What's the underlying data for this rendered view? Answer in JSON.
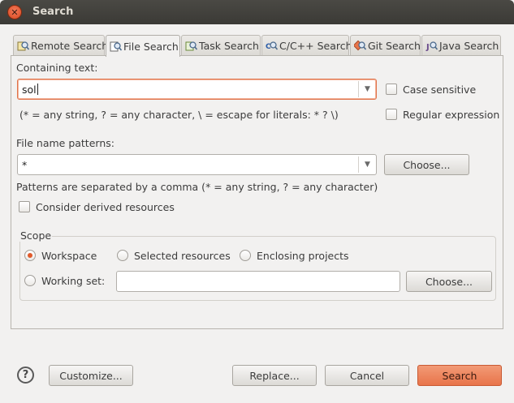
{
  "window": {
    "title": "Search"
  },
  "tabs": [
    {
      "label": "Remote Search",
      "icon": "remote-search-icon"
    },
    {
      "label": "File Search",
      "icon": "file-search-icon",
      "active": true
    },
    {
      "label": "Task Search",
      "icon": "task-search-icon"
    },
    {
      "label": "C/C++ Search",
      "icon": "cpp-search-icon"
    },
    {
      "label": "Git Search",
      "icon": "git-search-icon"
    },
    {
      "label": "Java Search",
      "icon": "java-search-icon"
    }
  ],
  "containing_text": {
    "label": "Containing text:",
    "value": "sol",
    "hint": "(* = any string, ? = any character, \\ = escape for literals: * ? \\)",
    "case_sensitive": {
      "label": "Case sensitive",
      "checked": false
    },
    "regular_expression": {
      "label": "Regular expression",
      "checked": false
    }
  },
  "file_name_patterns": {
    "label": "File name patterns:",
    "value": "*",
    "choose_label": "Choose...",
    "hint": "Patterns are separated by a comma (* = any string, ? = any character)"
  },
  "consider_derived": {
    "label": "Consider derived resources",
    "checked": false
  },
  "scope": {
    "legend": "Scope",
    "workspace": {
      "label": "Workspace",
      "selected": true
    },
    "selected_resources": {
      "label": "Selected resources",
      "selected": false
    },
    "enclosing_projects": {
      "label": "Enclosing projects",
      "selected": false
    },
    "working_set": {
      "label": "Working set:",
      "selected": false,
      "value": ""
    },
    "choose_label": "Choose..."
  },
  "footer": {
    "customize_label": "Customize...",
    "replace_label": "Replace...",
    "cancel_label": "Cancel",
    "search_label": "Search"
  },
  "colors": {
    "accent": "#e8744a",
    "titlebar": "#3c3b37",
    "background": "#f2f1f0"
  }
}
